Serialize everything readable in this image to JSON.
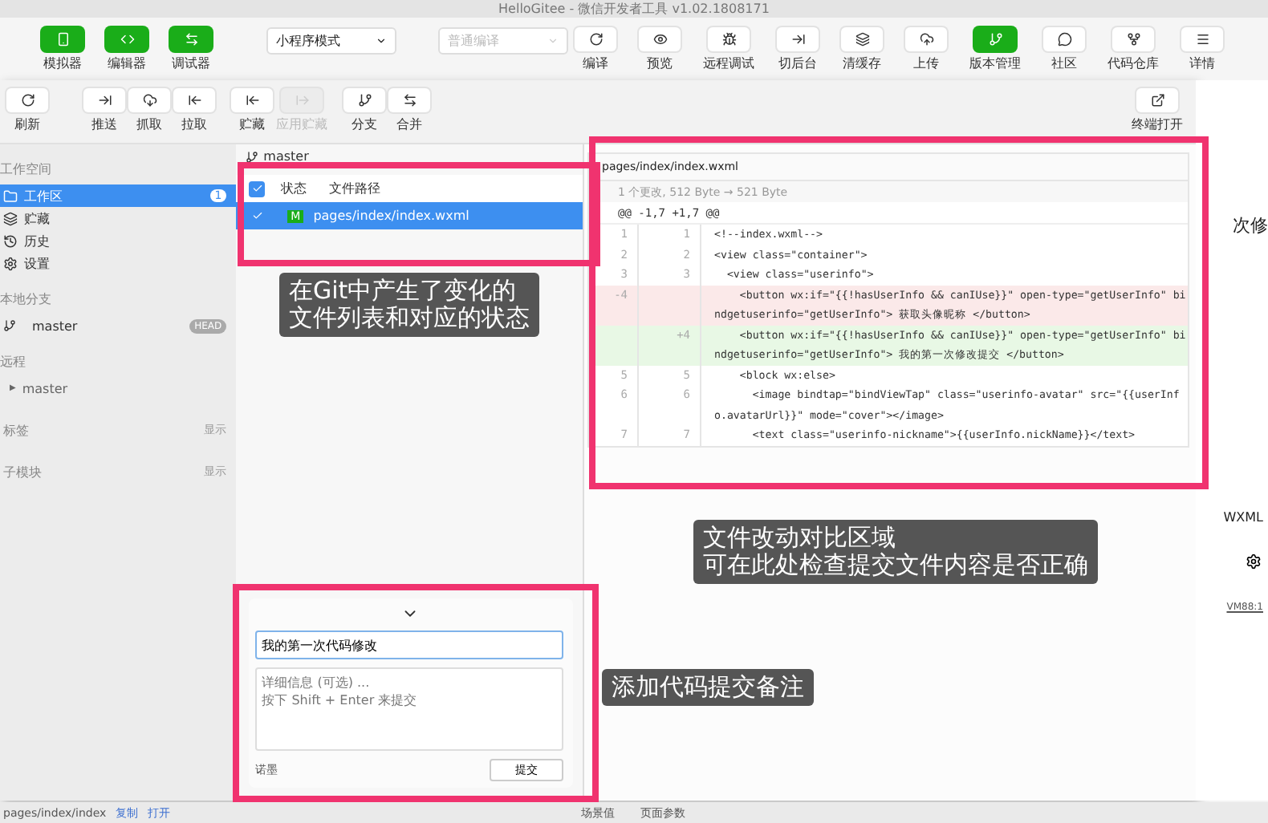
{
  "window": {
    "title": "HelloGitee - 微信开发者工具 v1.02.1808171"
  },
  "toolbar": {
    "modes": [
      {
        "label": "模拟器",
        "on": true
      },
      {
        "label": "编辑器",
        "on": true
      },
      {
        "label": "调试器",
        "on": true
      }
    ],
    "project_mode": {
      "value": "小程序模式",
      "disabled": false
    },
    "compile_mode": {
      "value": "普通编译",
      "disabled": true
    },
    "actions": [
      {
        "label": "编译",
        "on": false
      },
      {
        "label": "预览",
        "on": false
      },
      {
        "label": "远程调试",
        "on": false
      },
      {
        "label": "切后台",
        "on": false
      },
      {
        "label": "清缓存",
        "on": false
      },
      {
        "label": "上传",
        "on": false
      },
      {
        "label": "版本管理",
        "on": true
      },
      {
        "label": "社区",
        "on": false
      },
      {
        "label": "代码仓库",
        "on": false
      }
    ],
    "details": "详情"
  },
  "git_toolbar": {
    "groups": [
      [
        {
          "label": "刷新",
          "disabled": false
        }
      ],
      [
        {
          "label": "推送",
          "disabled": false
        },
        {
          "label": "抓取",
          "disabled": false
        },
        {
          "label": "拉取",
          "disabled": false
        }
      ],
      [
        {
          "label": "贮藏",
          "disabled": false
        },
        {
          "label": "应用贮藏",
          "disabled": true
        }
      ],
      [
        {
          "label": "分支",
          "disabled": false
        },
        {
          "label": "合并",
          "disabled": false
        }
      ]
    ],
    "terminal": "终端打开"
  },
  "sidebar": {
    "workspace_header": "工作空间",
    "items": [
      {
        "label": "工作区",
        "selected": true,
        "badge": "1"
      },
      {
        "label": "贮藏",
        "selected": false
      },
      {
        "label": "历史",
        "selected": false
      },
      {
        "label": "设置",
        "selected": false
      }
    ],
    "local_header": "本地分支",
    "branches": [
      {
        "name": "master",
        "tag": "HEAD"
      }
    ],
    "remote_header": "远程",
    "remotes": [
      {
        "name": "master",
        "expanded": false,
        "arrow": "▶"
      }
    ],
    "sections": [
      {
        "label": "标签",
        "action": "显示"
      },
      {
        "label": "子模块",
        "action": "显示"
      }
    ]
  },
  "changes": {
    "branch": "master",
    "columns": [
      "状态",
      "文件路径"
    ],
    "all_checked": true,
    "files": [
      {
        "checked": true,
        "status": "M",
        "path": "pages/index/index.wxml",
        "selected": true
      }
    ]
  },
  "diff": {
    "file": "pages/index/index.wxml",
    "summary": "1 个更改, 512 Byte → 521 Byte",
    "hunk": "@@ -1,7 +1,7 @@",
    "lines": [
      {
        "kind": "context",
        "old": "1",
        "new": "1",
        "text": "<!--index.wxml-->"
      },
      {
        "kind": "context",
        "old": "2",
        "new": "2",
        "text": "<view class=\"container\">"
      },
      {
        "kind": "context",
        "old": "3",
        "new": "3",
        "text": "  <view class=\"userinfo\">"
      },
      {
        "kind": "removed",
        "old": "-4",
        "text": "    <button wx:if=\"{{!hasUserInfo && canIUse}}\" open-type=\"getUserInfo\" bindgetuserinfo=\"getUserInfo\"> 获取头像昵称 </button>"
      },
      {
        "kind": "added",
        "new": "+4",
        "text": "    <button wx:if=\"{{!hasUserInfo && canIUse}}\" open-type=\"getUserInfo\" bindgetuserinfo=\"getUserInfo\"> 我的第一次修改提交 </button>"
      },
      {
        "kind": "context",
        "old": "5",
        "new": "5",
        "text": "    <block wx:else>"
      },
      {
        "kind": "context",
        "old": "6",
        "new": "6",
        "text": "      <image bindtap=\"bindViewTap\" class=\"userinfo-avatar\" src=\"{{userInfo.avatarUrl}}\" mode=\"cover\"></image>"
      },
      {
        "kind": "context",
        "old": "7",
        "new": "7",
        "text": "      <text class=\"userinfo-nickname\">{{userInfo.nickName}}</text>"
      }
    ]
  },
  "commit": {
    "summary": "我的第一次代码修改",
    "description_placeholder": "详细信息 (可选) ...\n按下 Shift + Enter 来提交",
    "author": "诺墨",
    "button": "提交"
  },
  "background_window": {
    "fragment": "次修",
    "tab": "WXML",
    "link": "VM88:1"
  },
  "status_bar": {
    "path": "pages/index/index",
    "links": [
      "复制",
      "打开"
    ],
    "tabs": [
      "场景值",
      "页面参数"
    ]
  },
  "annotations": [
    {
      "lines": [
        "在Git中产生了变化的",
        "文件列表和对应的状态"
      ]
    },
    {
      "lines": [
        "文件改动对比区域",
        "可在此处检查提交文件内容是否正确"
      ]
    },
    {
      "lines": [
        "添加代码提交备注"
      ]
    }
  ]
}
